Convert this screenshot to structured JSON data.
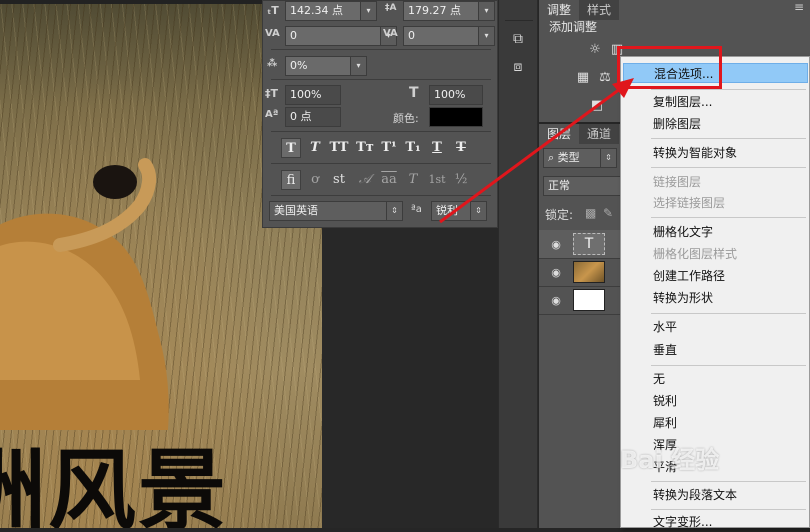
{
  "canvas": {
    "text": "洲风景"
  },
  "character": {
    "font_size": "142.34 点",
    "leading": "179.27 点",
    "kerning": "0",
    "tracking": "0",
    "tsume": "0%",
    "vscale": "100%",
    "hscale": "100%",
    "baseline": "0 点",
    "color_label": "颜色:",
    "style_buttons": [
      "T",
      "T",
      "TT",
      "Tт",
      "T¹",
      "T₁",
      "T",
      "T"
    ],
    "opentype_buttons": [
      "fi",
      "ơ",
      "st",
      "𝒜",
      "aa",
      "T",
      "1st",
      "½"
    ],
    "language": "美国英语",
    "aa_label": "ªa",
    "antialias": "锐利",
    "icons": {
      "size": "font-size-icon",
      "leading": "leading-icon"
    }
  },
  "adjustments": {
    "tabs": [
      "调整",
      "样式"
    ],
    "title": "添加调整"
  },
  "layers": {
    "tabs": [
      "图层",
      "通道"
    ],
    "filter": "类型",
    "blend_mode": "正常",
    "lock_label": "锁定:",
    "rows": [
      {
        "thumb_text": "T",
        "kind": "text"
      },
      {
        "thumb_text": "",
        "kind": "image"
      },
      {
        "thumb_text": "",
        "kind": "white"
      }
    ]
  },
  "context_menu": {
    "items": [
      {
        "label": "混合选项...",
        "state": "highlighted"
      },
      {
        "label": "复制图层...",
        "state": "normal"
      },
      {
        "label": "删除图层",
        "state": "normal"
      },
      {
        "label": "转换为智能对象",
        "state": "normal"
      },
      {
        "label": "链接图层",
        "state": "disabled"
      },
      {
        "label": "选择链接图层",
        "state": "disabled"
      },
      {
        "label": "栅格化文字",
        "state": "normal"
      },
      {
        "label": "栅格化图层样式",
        "state": "disabled"
      },
      {
        "label": "创建工作路径",
        "state": "normal"
      },
      {
        "label": "转换为形状",
        "state": "normal"
      },
      {
        "label": "水平",
        "state": "normal"
      },
      {
        "label": "垂直",
        "state": "normal"
      },
      {
        "label": "无",
        "state": "normal"
      },
      {
        "label": "锐利",
        "state": "normal"
      },
      {
        "label": "犀利",
        "state": "normal"
      },
      {
        "label": "浑厚",
        "state": "normal"
      },
      {
        "label": "平滑",
        "state": "normal"
      },
      {
        "label": "转换为段落文本",
        "state": "normal"
      },
      {
        "label": "文字变形...",
        "state": "normal"
      }
    ]
  },
  "watermark": "Bai 经验",
  "colors": {
    "accent_red": "#e0161c",
    "highlight": "#91c9f7",
    "panel": "#535353"
  }
}
